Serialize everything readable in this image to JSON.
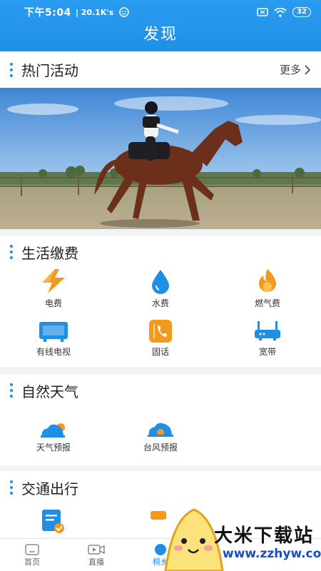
{
  "status_bar": {
    "time": "下午5:04",
    "speed": "20.1K's",
    "battery": "32"
  },
  "header": {
    "title": "发现"
  },
  "hot": {
    "title": "热门活动",
    "more": "更多"
  },
  "life": {
    "title": "生活缴费",
    "items": [
      {
        "label": "电费",
        "icon": "lightning-icon"
      },
      {
        "label": "水费",
        "icon": "water-drop-icon"
      },
      {
        "label": "燃气费",
        "icon": "gas-flame-icon"
      },
      {
        "label": "有线电视",
        "icon": "tv-icon"
      },
      {
        "label": "固话",
        "icon": "phone-icon"
      },
      {
        "label": "宽带",
        "icon": "router-icon"
      }
    ]
  },
  "weather": {
    "title": "自然天气",
    "items": [
      {
        "label": "天气预报",
        "icon": "weather-cloud-icon"
      },
      {
        "label": "台风预报",
        "icon": "typhoon-icon"
      }
    ]
  },
  "traffic": {
    "title": "交通出行"
  },
  "tabs": [
    {
      "label": "首页"
    },
    {
      "label": "直播"
    },
    {
      "label": "桐乡"
    },
    {
      "label": ""
    },
    {
      "label": ""
    }
  ],
  "watermark": {
    "name": "大米下载站",
    "url": "www.zzhyw.com"
  },
  "colors": {
    "accent": "#1f8fe6",
    "orange": "#f39a1e"
  }
}
